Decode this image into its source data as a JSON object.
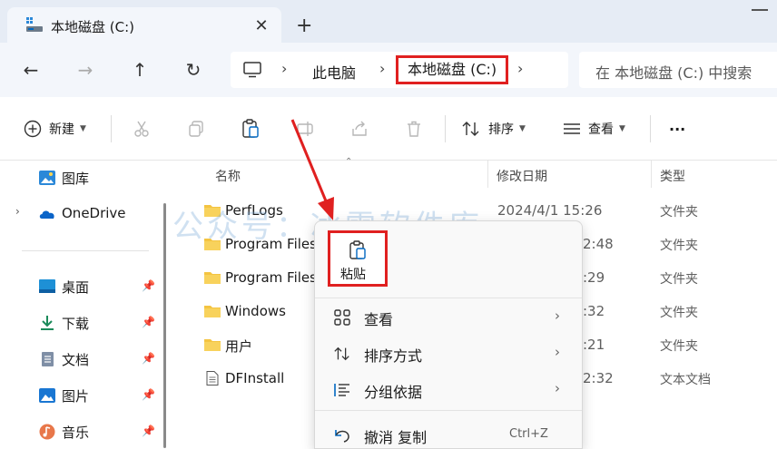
{
  "tab": {
    "title": "本地磁盘 (C:)",
    "close": "✕",
    "new_tab": "+"
  },
  "nav": {
    "back": "←",
    "forward": "→",
    "up": "↑",
    "refresh": "↻"
  },
  "breadcrumb": {
    "sep": "›",
    "items": [
      "此电脑",
      "本地磁盘 (C:)"
    ]
  },
  "search": {
    "placeholder": "在 本地磁盘 (C:) 中搜索"
  },
  "commands": {
    "new_label": "新建",
    "sort_label": "排序",
    "view_label": "查看",
    "more": "···"
  },
  "sidebar": {
    "items": [
      {
        "label": "图库",
        "icon": "gallery-icon",
        "pinned": false
      },
      {
        "label": "OneDrive",
        "icon": "cloud-icon",
        "pinned": false
      },
      {
        "label": "桌面",
        "icon": "desktop-icon",
        "pinned": true
      },
      {
        "label": "下载",
        "icon": "download-icon",
        "pinned": true
      },
      {
        "label": "文档",
        "icon": "document-icon",
        "pinned": true
      },
      {
        "label": "图片",
        "icon": "pictures-icon",
        "pinned": true
      },
      {
        "label": "音乐",
        "icon": "music-icon",
        "pinned": true
      }
    ],
    "expand": "›"
  },
  "columns": {
    "name": "名称",
    "date": "修改日期",
    "type": "类型"
  },
  "files": [
    {
      "name": "PerfLogs",
      "date": "2024/4/1 15:26",
      "type": "文件夹",
      "kind": "folder"
    },
    {
      "name": "Program Files",
      "date": "2:48",
      "type": "文件夹",
      "kind": "folder"
    },
    {
      "name": "Program Files",
      "date": ":29",
      "type": "文件夹",
      "kind": "folder"
    },
    {
      "name": "Windows",
      "date": ":32",
      "type": "文件夹",
      "kind": "folder"
    },
    {
      "name": "用户",
      "date": ":21",
      "type": "文件夹",
      "kind": "folder"
    },
    {
      "name": "DFInstall",
      "date": "2:32",
      "type": "文本文档",
      "kind": "text"
    }
  ],
  "watermark": "公众号：冰雪软件库",
  "context_menu": {
    "quick_paste": "粘贴",
    "items": [
      {
        "label": "查看",
        "icon": "grid-icon",
        "arrow": "›"
      },
      {
        "label": "排序方式",
        "icon": "sort-icon",
        "arrow": "›"
      },
      {
        "label": "分组依据",
        "icon": "group-icon",
        "arrow": "›"
      },
      {
        "label": "撤消 复制",
        "icon": "undo-icon",
        "shortcut": "Ctrl+Z"
      }
    ]
  },
  "colors": {
    "highlight": "#e02020",
    "accent": "#0067c0",
    "folder": "#f4c441"
  }
}
